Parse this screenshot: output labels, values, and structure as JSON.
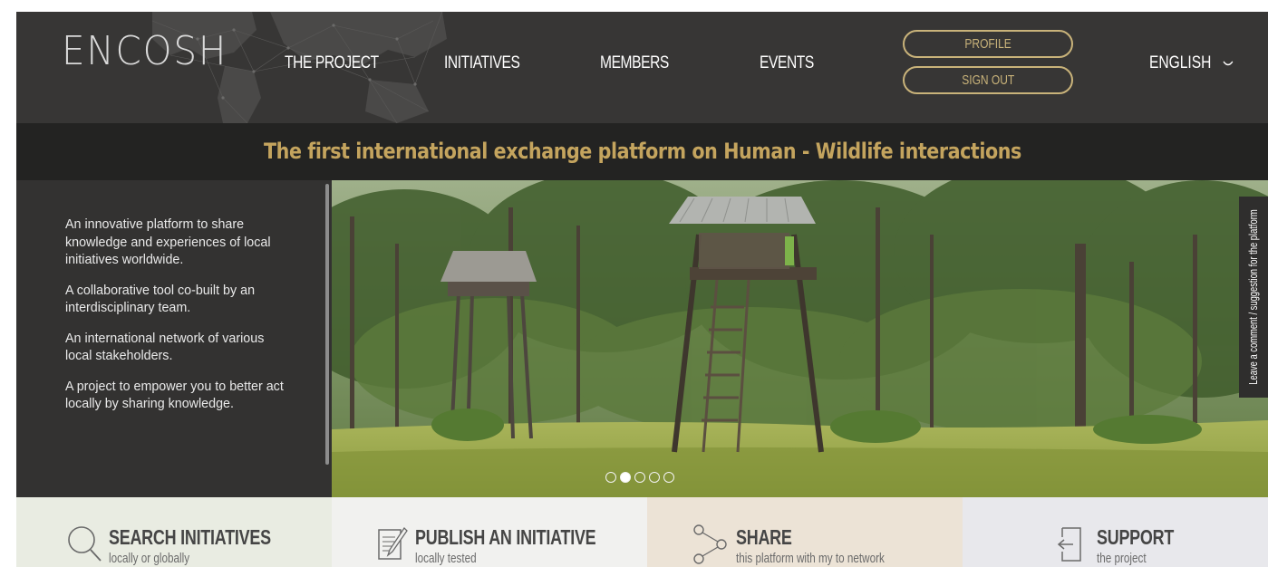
{
  "header": {
    "logo": "ENCOSH",
    "nav": [
      "THE PROJECT",
      "INITIATIVES",
      "MEMBERS",
      "EVENTS"
    ],
    "profile_label": "PROFILE",
    "signout_label": "SIGN OUT",
    "language": "ENGLISH",
    "language_icon": "chevron-down-icon"
  },
  "banner": {
    "title": "The first international exchange platform on Human - Wildlife interactions"
  },
  "sidebar": {
    "paragraphs": [
      "An innovative platform to share knowledge and experiences of local initiatives worldwide.",
      "A collaborative tool co-built by an interdisciplinary team.",
      "An international network of various local stakeholders.",
      "A project to empower you to better act locally by sharing knowledge."
    ]
  },
  "hero": {
    "slides_count": 5,
    "active_slide": 2,
    "feedback_label": "Leave a comment / suggestion for the platform"
  },
  "tiles": [
    {
      "title": "SEARCH INITIATIVES",
      "subtitle": "locally or globally",
      "icon": "search-icon",
      "bg": "#e9ece2"
    },
    {
      "title": "PUBLISH AN INITIATIVE",
      "subtitle": "locally tested",
      "icon": "document-edit-icon",
      "bg": "#f1f1ef"
    },
    {
      "title": "SHARE",
      "subtitle": "this platform with my to network",
      "icon": "share-icon",
      "bg": "#ece3d6"
    },
    {
      "title": "SUPPORT",
      "subtitle": "the project",
      "icon": "door-enter-icon",
      "bg": "#e8e8ec"
    }
  ],
  "colors": {
    "header_bg": "#373635",
    "banner_bg": "#232322",
    "accent_gold": "#c4a45e",
    "button_outline": "#c9b37a"
  }
}
